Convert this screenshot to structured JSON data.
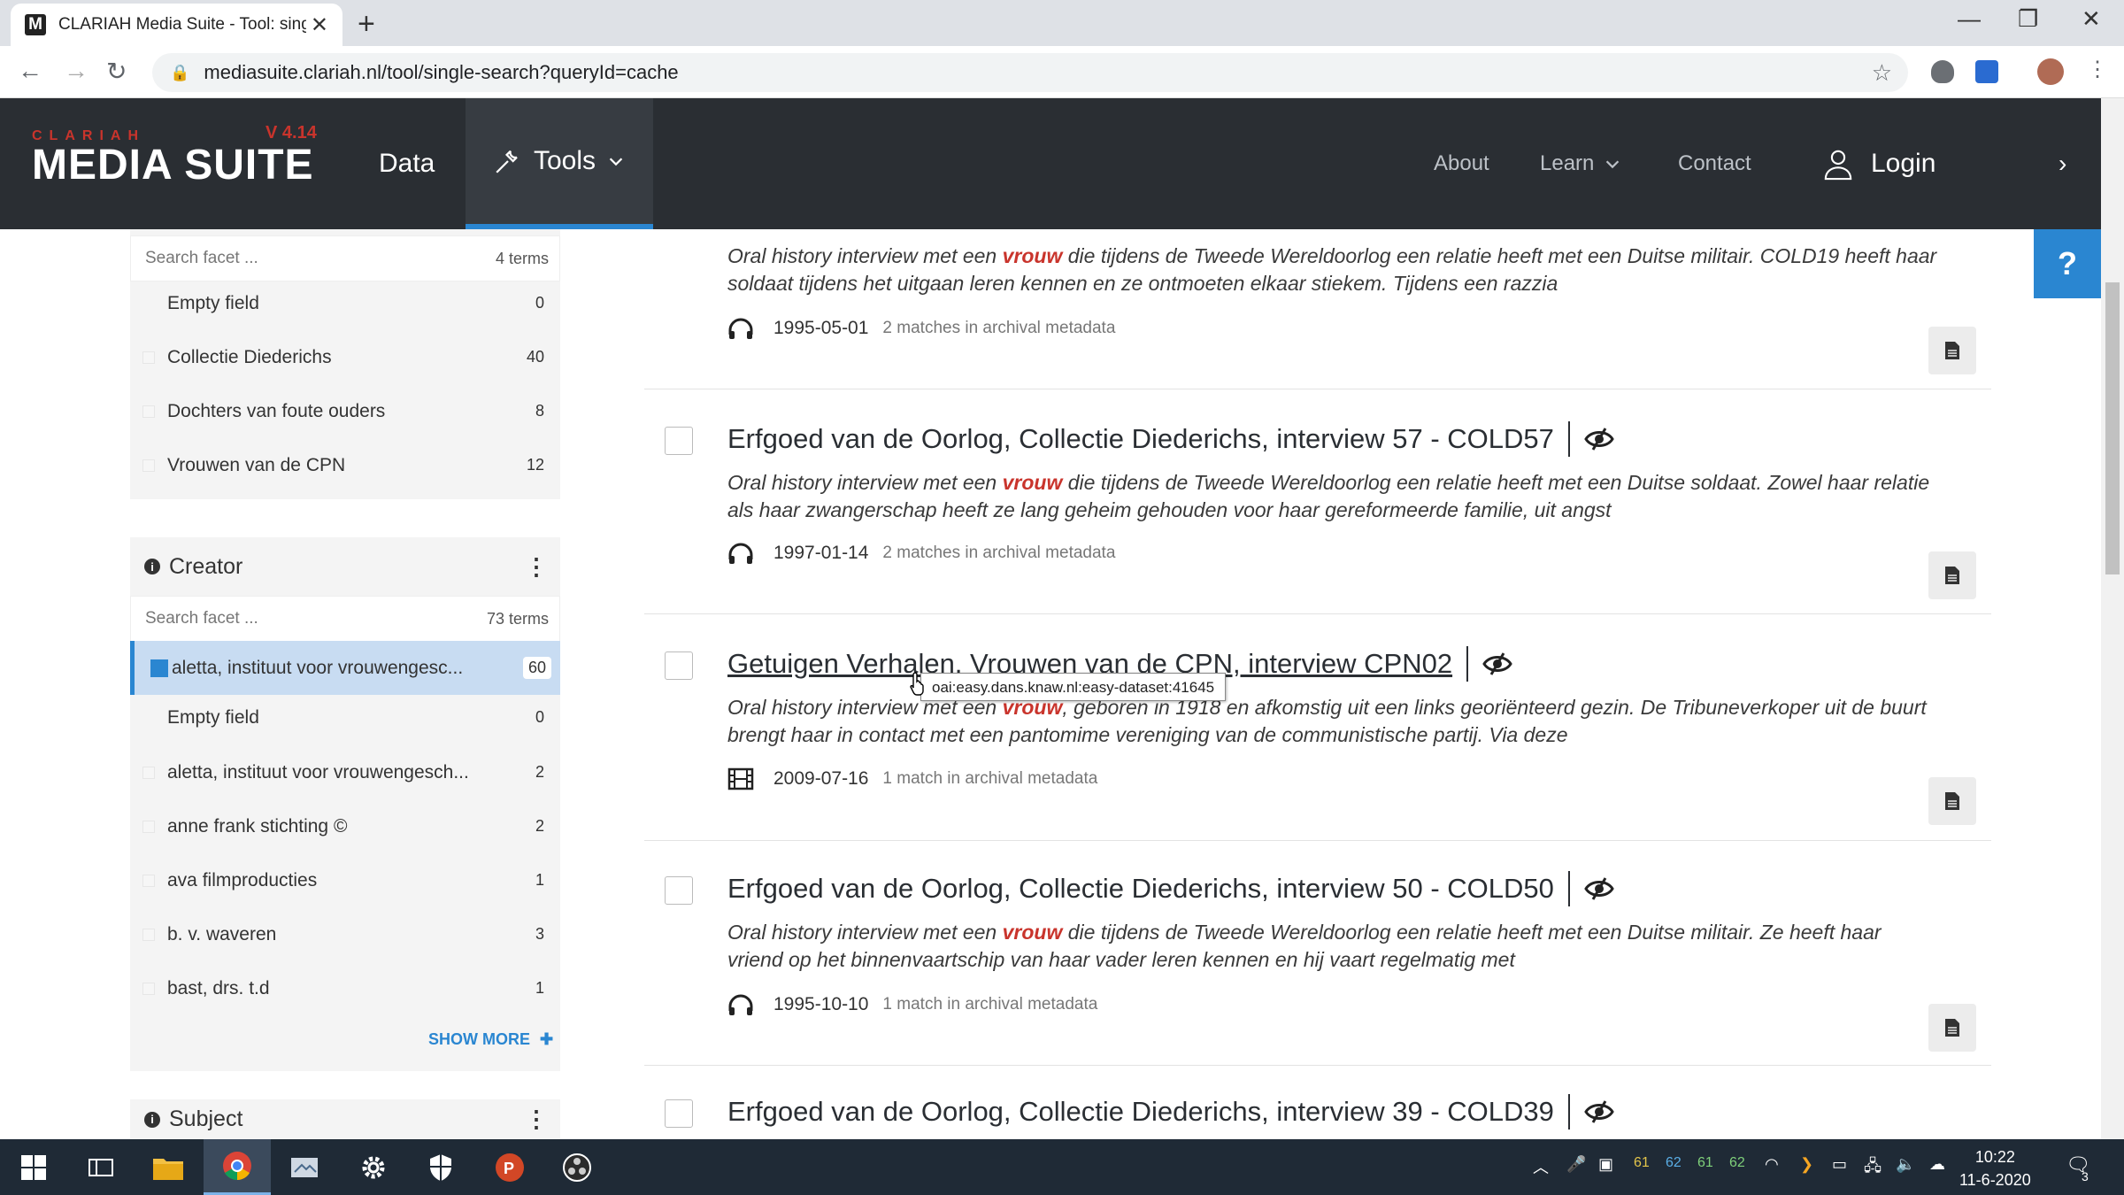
{
  "browser": {
    "tab_title": "CLARIAH Media Suite - Tool: sing",
    "url": "mediasuite.clariah.nl/tool/single-search?queryId=cache"
  },
  "header": {
    "logo_small": "CLARIAH",
    "version": "V 4.14",
    "logo_big": "MEDIA SUITE",
    "nav_data": "Data",
    "nav_tools": "Tools",
    "nav_about": "About",
    "nav_learn": "Learn",
    "nav_contact": "Contact",
    "nav_login": "Login",
    "help": "?"
  },
  "sidebar": {
    "collection_facet": {
      "search_placeholder": "Search facet ...",
      "terms": "4 terms",
      "items": [
        {
          "label": "Empty field",
          "count": "0"
        },
        {
          "label": "Collectie Diederichs",
          "count": "40"
        },
        {
          "label": "Dochters van foute ouders",
          "count": "8"
        },
        {
          "label": "Vrouwen van de CPN",
          "count": "12"
        }
      ]
    },
    "creator_facet": {
      "title": "Creator",
      "search_placeholder": "Search facet ...",
      "terms": "73 terms",
      "selected": {
        "label": "aletta, instituut voor vrouwengesc...",
        "count": "60"
      },
      "items": [
        {
          "label": "Empty field",
          "count": "0"
        },
        {
          "label": "aletta, instituut voor vrouwengesch...",
          "count": "2"
        },
        {
          "label": "anne frank stichting ©",
          "count": "2"
        },
        {
          "label": "ava filmproducties",
          "count": "1"
        },
        {
          "label": "b. v. waveren",
          "count": "3"
        },
        {
          "label": "bast, drs. t.d",
          "count": "1"
        }
      ],
      "show_more": "SHOW MORE"
    },
    "subject_facet": {
      "title": "Subject"
    }
  },
  "results": [
    {
      "title": "",
      "desc_pre": "Oral history interview met een ",
      "highlight": "vrouw",
      "desc_post": " die tijdens de Tweede Wereldoorlog een relatie heeft met een Duitse militair. COLD19 heeft haar soldaat tijdens het uitgaan leren kennen en ze ontmoeten elkaar stiekem. Tijdens een razzia",
      "date": "1995-05-01",
      "matches": "2 matches in archival metadata",
      "media": "audio"
    },
    {
      "title": "Erfgoed van de Oorlog, Collectie Diederichs, interview 57 - COLD57",
      "desc_pre": "Oral history interview met een ",
      "highlight": "vrouw",
      "desc_post": " die tijdens de Tweede Wereldoorlog een relatie heeft met een Duitse soldaat. Zowel haar relatie als haar zwangerschap heeft ze lang geheim gehouden voor haar gereformeerde familie, uit angst",
      "date": "1997-01-14",
      "matches": "2 matches in archival metadata",
      "media": "audio"
    },
    {
      "title": "Getuigen Verhalen, Vrouwen van de CPN, interview CPN02",
      "desc_pre": "Oral history interview met een ",
      "highlight": "vrouw",
      "desc_post": ", geboren in 1918 en afkomstig uit een links georiënteerd gezin. De Tribuneverkoper uit de buurt brengt haar in contact met een pantomime vereniging van de communistische partij. Via deze",
      "date": "2009-07-16",
      "matches": "1 match in archival metadata",
      "media": "video"
    },
    {
      "title": "Erfgoed van de Oorlog, Collectie Diederichs, interview 50 - COLD50",
      "desc_pre": "Oral history interview met een ",
      "highlight": "vrouw",
      "desc_post": " die tijdens de Tweede Wereldoorlog een relatie heeft met een Duitse militair. Ze heeft haar vriend op het binnenvaartschip van haar vader leren kennen en hij vaart regelmatig met",
      "date": "1995-10-10",
      "matches": "1 match in archival metadata",
      "media": "audio"
    },
    {
      "title": "Erfgoed van de Oorlog, Collectie Diederichs, interview 39 - COLD39"
    }
  ],
  "tooltip": "oai:easy.dans.knaw.nl:easy-dataset:41645",
  "taskbar": {
    "tray_nums": [
      "61",
      "62",
      "61",
      "62"
    ],
    "time": "10:22",
    "date": "11-6-2020",
    "notif": "3"
  }
}
